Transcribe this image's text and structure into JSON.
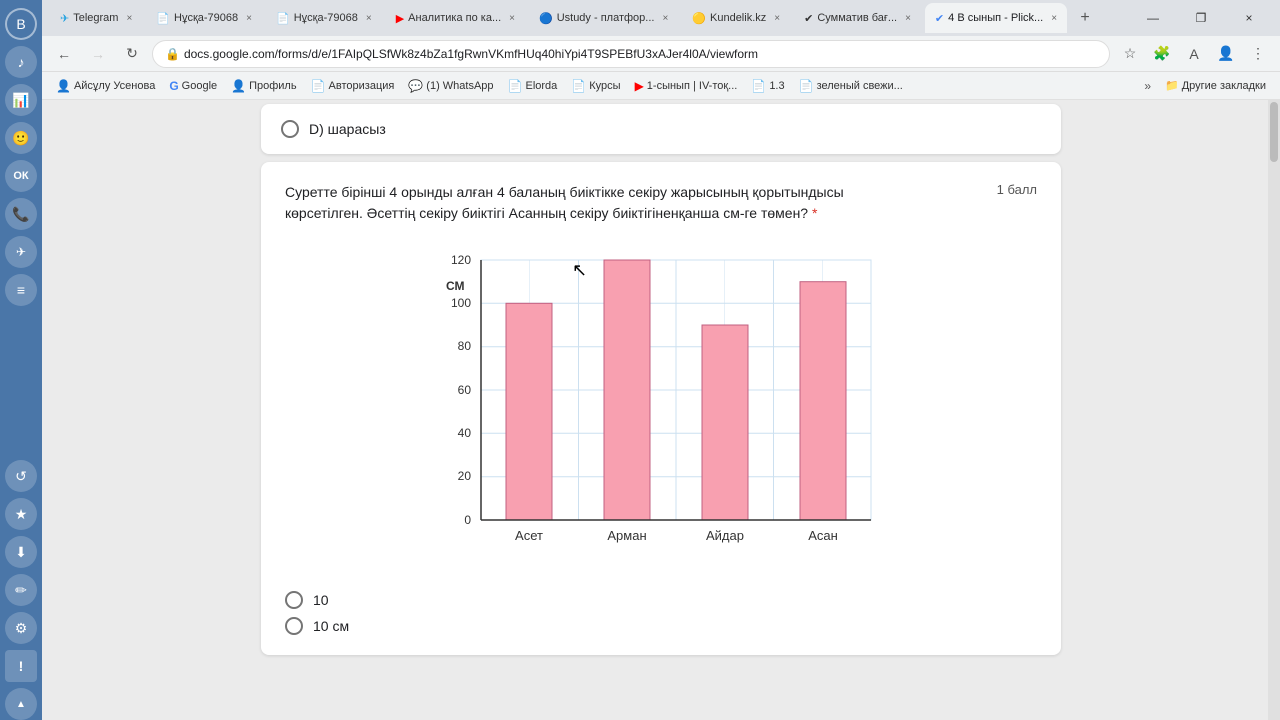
{
  "browser": {
    "tabs": [
      {
        "id": "telegram",
        "label": "Telegram",
        "icon": "✈",
        "iconColor": "#2CA5E0",
        "active": false
      },
      {
        "id": "nuska1",
        "label": "Нұсқа-79068",
        "icon": "📄",
        "iconColor": "#4285f4",
        "active": false
      },
      {
        "id": "nuska2",
        "label": "Нұсқа-79068",
        "icon": "📄",
        "iconColor": "#34a853",
        "active": false
      },
      {
        "id": "analytics",
        "label": "Аналитика по ка...",
        "icon": "▶",
        "iconColor": "#ff0000",
        "active": false
      },
      {
        "id": "ustudy",
        "label": "Ustudy - платфор...",
        "icon": "U",
        "iconColor": "#555",
        "active": false
      },
      {
        "id": "kundelik",
        "label": "Kundelik.kz",
        "icon": "K",
        "iconColor": "#555",
        "active": false
      },
      {
        "id": "summative",
        "label": "Сумматив бағ...",
        "icon": "✔",
        "iconColor": "#555",
        "active": false
      },
      {
        "id": "4b",
        "label": "4 В сынып - Plick...",
        "icon": "✔",
        "iconColor": "#4285f4",
        "active": true
      }
    ],
    "address": "docs.google.com/forms/d/e/1FAIpQLSfWk8z4bZa1fgRwnVKmfHUq40hiYpi4T9SPEBfU3xAJer4l0A/viewform",
    "bookmarks": [
      {
        "label": "Айсұлу Усенова",
        "icon": "👤"
      },
      {
        "label": "Google",
        "icon": "G"
      },
      {
        "label": "Профиль",
        "icon": "👤"
      },
      {
        "label": "Авторизация",
        "icon": "📄"
      },
      {
        "label": "(1) WhatsApp",
        "icon": "💬"
      },
      {
        "label": "Elorda",
        "icon": "📄"
      },
      {
        "label": "Курсы",
        "icon": "📄"
      },
      {
        "label": "1-сынып | IV-тоқ...",
        "icon": "▶"
      },
      {
        "label": "1.3",
        "icon": "📄"
      },
      {
        "label": "зеленый свежи...",
        "icon": "📄"
      }
    ]
  },
  "sidebar": {
    "icons": [
      {
        "name": "vk-icon",
        "symbol": "В"
      },
      {
        "name": "music-icon",
        "symbol": "♪"
      },
      {
        "name": "stats-icon",
        "symbol": "📊"
      },
      {
        "name": "face-icon",
        "symbol": "😊"
      },
      {
        "name": "ok-icon",
        "symbol": "О"
      },
      {
        "name": "phone-icon",
        "symbol": "📞"
      },
      {
        "name": "telegram-icon",
        "symbol": "✈"
      },
      {
        "name": "list-icon",
        "symbol": "≡"
      },
      {
        "name": "refresh-icon",
        "symbol": "↺"
      },
      {
        "name": "star-icon",
        "symbol": "★"
      },
      {
        "name": "down-icon",
        "symbol": "⬇"
      },
      {
        "name": "pen-icon",
        "symbol": "✏"
      },
      {
        "name": "gear-icon",
        "symbol": "⚙"
      },
      {
        "name": "excl-icon",
        "symbol": "!"
      },
      {
        "name": "up-icon",
        "symbol": "⌃"
      }
    ]
  },
  "page": {
    "partial_answer": {
      "option_d": "D) шарасыз"
    },
    "question": {
      "text": "Суретте бірінші 4 орынды алған 4 баланың биіктікке секіру жарысының қорытындысы көрсетілген. Әсеттің секіру биіктігі Асанның секіру биіктігіненқанша см-ге төмен?",
      "required": true,
      "points": "1 балл",
      "chart": {
        "y_label": "СМ",
        "y_max": 120,
        "y_min": 0,
        "y_step": 20,
        "bars": [
          {
            "name": "Асет",
            "value": 100,
            "color": "#f8a0b0"
          },
          {
            "name": "Арман",
            "value": 120,
            "color": "#f8a0b0"
          },
          {
            "name": "Айдар",
            "value": 90,
            "color": "#f8a0b0"
          },
          {
            "name": "Асан",
            "value": 110,
            "color": "#f8a0b0"
          }
        ]
      },
      "answers": [
        {
          "value": "10",
          "label": "10"
        },
        {
          "value": "10cm",
          "label": "10 см"
        }
      ]
    }
  }
}
